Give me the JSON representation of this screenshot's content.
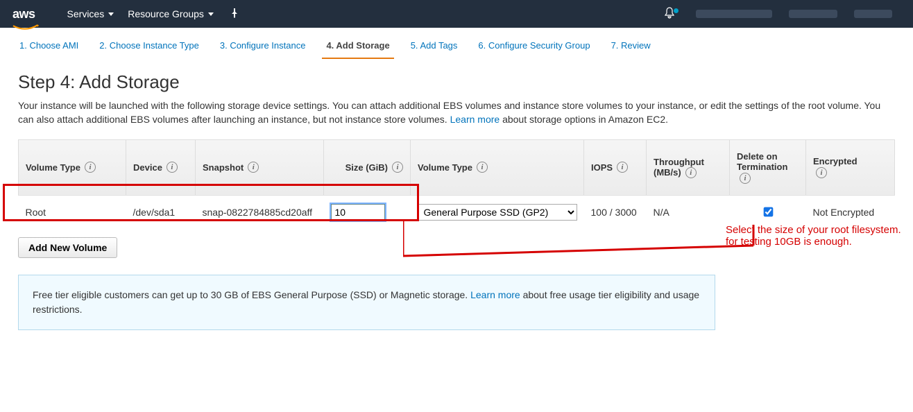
{
  "topnav": {
    "logo_text": "aws",
    "services_label": "Services",
    "resource_groups_label": "Resource Groups"
  },
  "steps": [
    {
      "label": "1. Choose AMI"
    },
    {
      "label": "2. Choose Instance Type"
    },
    {
      "label": "3. Configure Instance"
    },
    {
      "label": "4. Add Storage",
      "active": true
    },
    {
      "label": "5. Add Tags"
    },
    {
      "label": "6. Configure Security Group"
    },
    {
      "label": "7. Review"
    }
  ],
  "page": {
    "title": "Step 4: Add Storage",
    "description_pre": "Your instance will be launched with the following storage device settings. You can attach additional EBS volumes and instance store volumes to your instance, or edit the settings of the root volume. You can also attach additional EBS volumes after launching an instance, but not instance store volumes. ",
    "learn_more": "Learn more",
    "description_post": " about storage options in Amazon EC2."
  },
  "table": {
    "headers": {
      "volume_type_left": "Volume Type",
      "device": "Device",
      "snapshot": "Snapshot",
      "size": "Size (GiB)",
      "volume_type_right": "Volume Type",
      "iops": "IOPS",
      "throughput_l1": "Throughput",
      "throughput_l2": "(MB/s)",
      "delete_l1": "Delete on",
      "delete_l2": "Termination",
      "encrypted": "Encrypted"
    },
    "row": {
      "voltype_left": "Root",
      "device": "/dev/sda1",
      "snapshot": "snap-0822784885cd20aff",
      "size_value": "10",
      "voltype_right": "General Purpose SSD (GP2)",
      "iops": "100 / 3000",
      "throughput": "N/A",
      "delete_on_termination": true,
      "encrypted": "Not Encrypted"
    }
  },
  "buttons": {
    "add_new_volume": "Add New Volume"
  },
  "info_box": {
    "pre": "Free tier eligible customers can get up to 30 GB of EBS General Purpose (SSD) or Magnetic storage. ",
    "learn_more": "Learn more",
    "post": " about free usage tier eligibility and usage restrictions."
  },
  "annotation": {
    "line1": "Select the size of your root filesystem.",
    "line2": "for testing 10GB is enough."
  }
}
